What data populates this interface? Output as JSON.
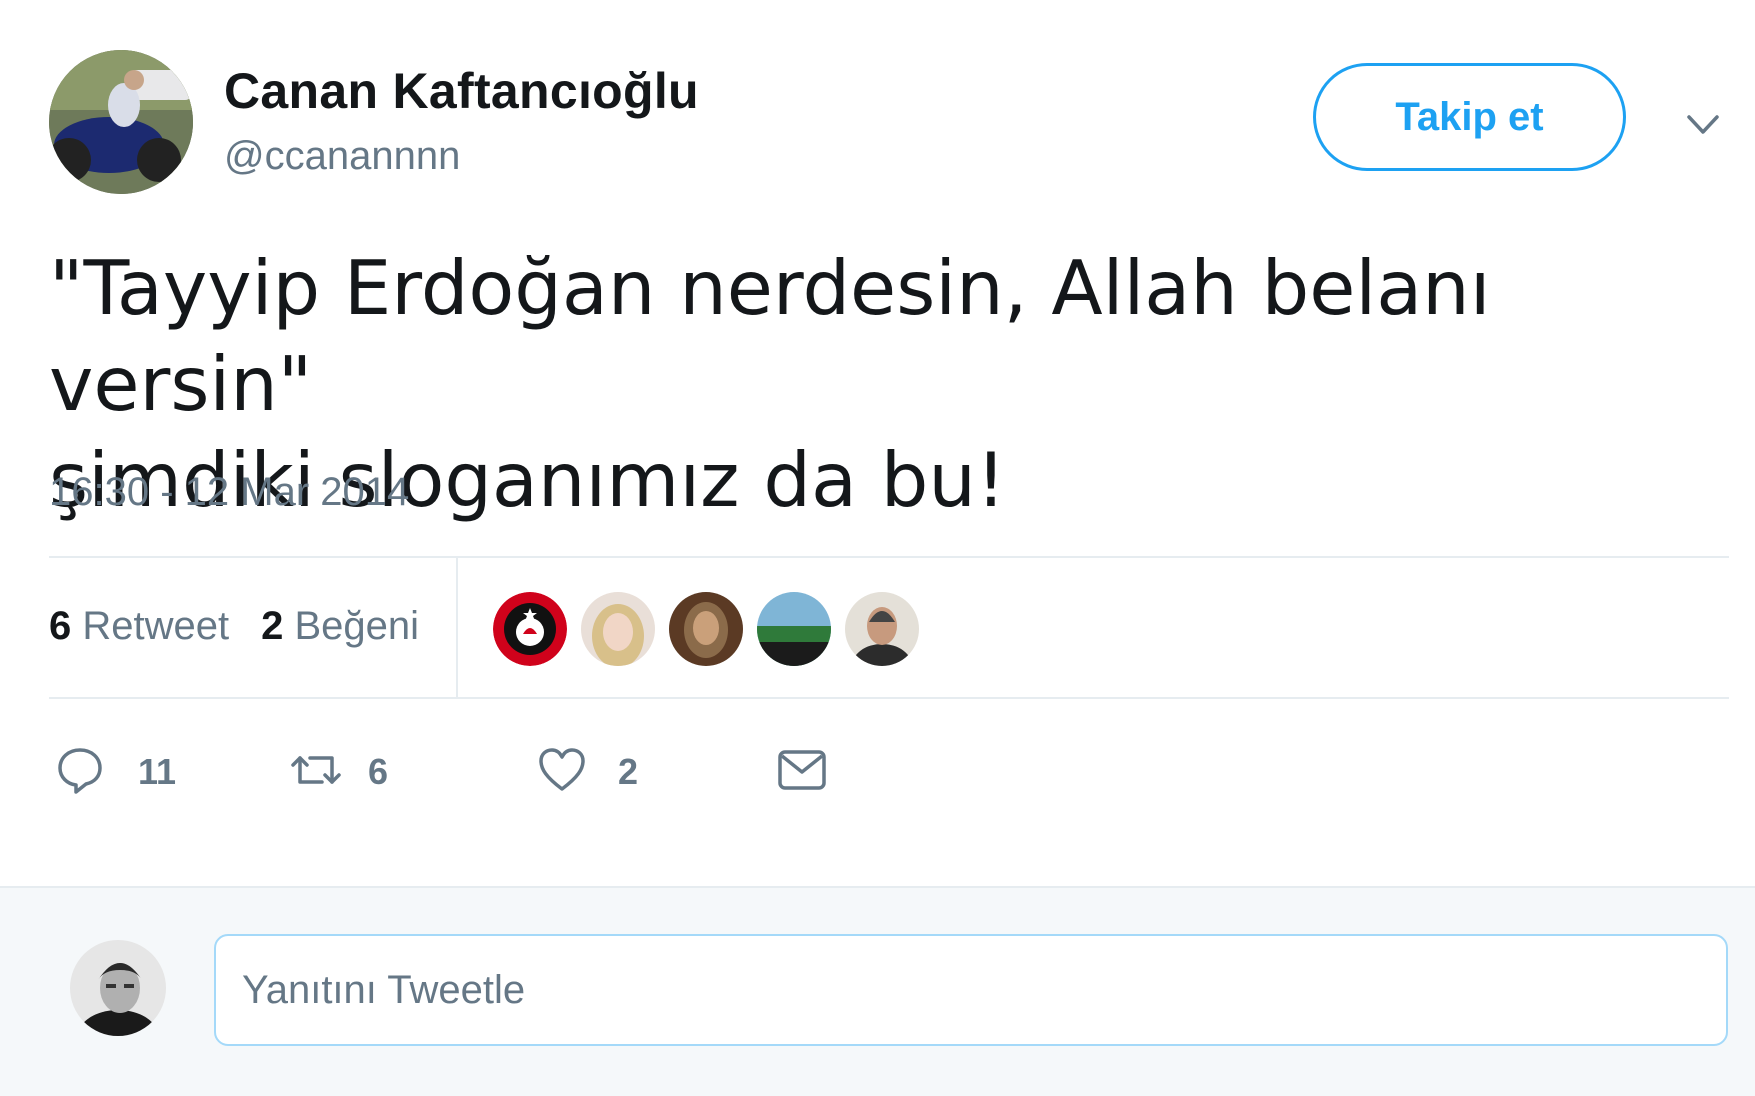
{
  "author": {
    "name": "Canan Kaftancıoğlu",
    "handle": "@ccanannnn"
  },
  "header": {
    "follow_label": "Takip et"
  },
  "tweet": {
    "text_line1": "\"Tayyip Erdoğan nerdesin, Allah belanı versin\"",
    "text_line2": "şimdiki sloganımız da bu!",
    "timestamp": "16:30 - 12 Mar 2014"
  },
  "stats": {
    "retweet_count": "6",
    "retweet_label": "Retweet",
    "like_count": "2",
    "like_label": "Beğeni"
  },
  "actions": {
    "reply_count": "11",
    "retweet_count": "6",
    "like_count": "2"
  },
  "reply": {
    "placeholder": "Yanıtını Tweetle"
  },
  "colors": {
    "accent": "#1da1f2",
    "secondary_text": "#657786",
    "primary_text": "#14171a"
  }
}
